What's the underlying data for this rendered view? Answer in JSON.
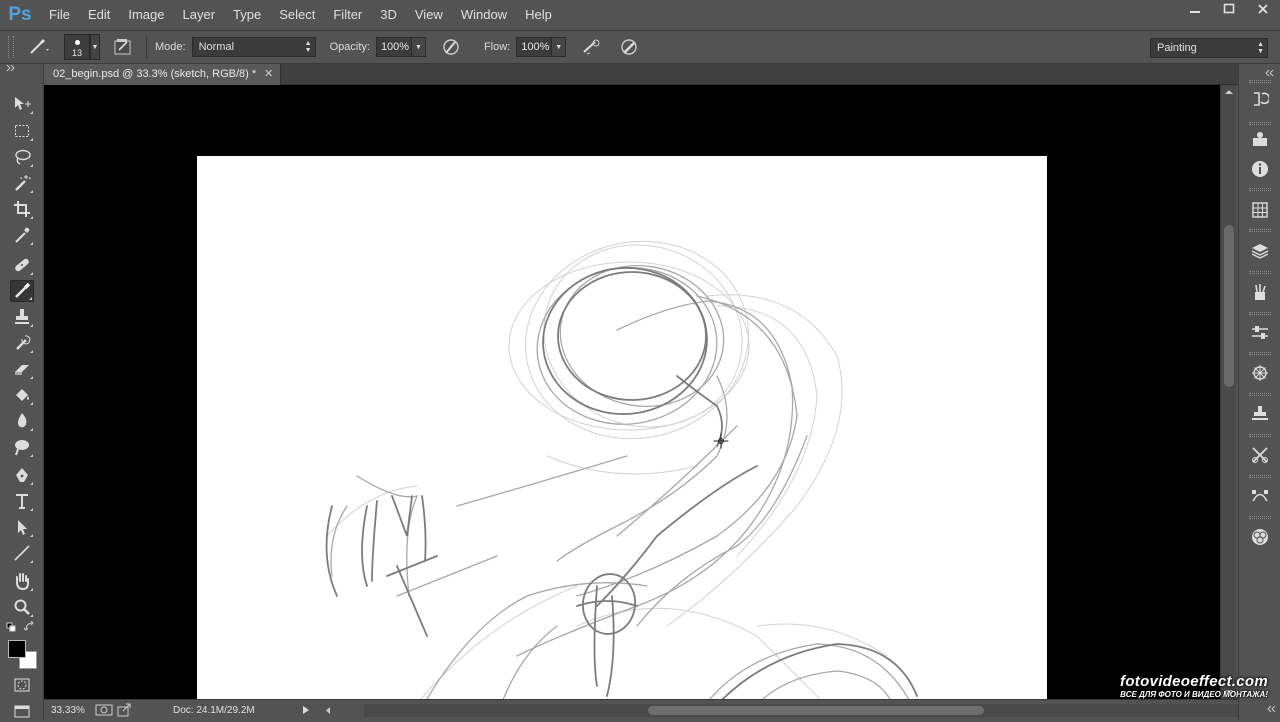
{
  "app": {
    "logo": "Ps"
  },
  "menu": [
    "File",
    "Edit",
    "Image",
    "Layer",
    "Type",
    "Select",
    "Filter",
    "3D",
    "View",
    "Window",
    "Help"
  ],
  "window_controls": {
    "minimize": "–",
    "maximize": "▫",
    "close": "✕"
  },
  "options": {
    "brush_size": "13",
    "mode_label": "Mode:",
    "mode_value": "Normal",
    "opacity_label": "Opacity:",
    "opacity_value": "100%",
    "flow_label": "Flow:",
    "flow_value": "100%",
    "workspace": "Painting"
  },
  "document": {
    "tab_title": "02_begin.psd @ 33.3% (sketch, RGB/8) *",
    "close": "✕"
  },
  "status": {
    "zoom": "33.33%",
    "doc_info": "Doc: 24.1M/29.2M"
  },
  "watermark": {
    "line1": "fotovideoeffect.com",
    "line2": "ВСЕ ДЛЯ ФОТО И ВИДЕО МОНТАЖА!"
  },
  "colors": {
    "foreground": "#000000",
    "background": "#ffffff",
    "ui": "#535353",
    "canvas_bg": "#000000"
  },
  "tools": [
    "move-tool",
    "marquee-tool",
    "lasso-tool",
    "magic-wand-tool",
    "crop-tool",
    "eyedropper-tool",
    "healing-brush-tool",
    "brush-tool",
    "clone-stamp-tool",
    "history-brush-tool",
    "eraser-tool",
    "paint-bucket-tool",
    "blur-tool",
    "dodge-tool",
    "pen-tool",
    "type-tool",
    "path-selection-tool",
    "line-tool",
    "hand-tool",
    "zoom-tool"
  ],
  "active_tool": "brush-tool",
  "right_panels": [
    "history-icon",
    "properties-icon",
    "info-icon",
    "swatches-icon",
    "layers-icon",
    "brush-presets-icon",
    "adjustments-icon",
    "navigator-icon",
    "clone-source-icon",
    "tool-presets-icon",
    "paths-icon",
    "styles-icon"
  ]
}
